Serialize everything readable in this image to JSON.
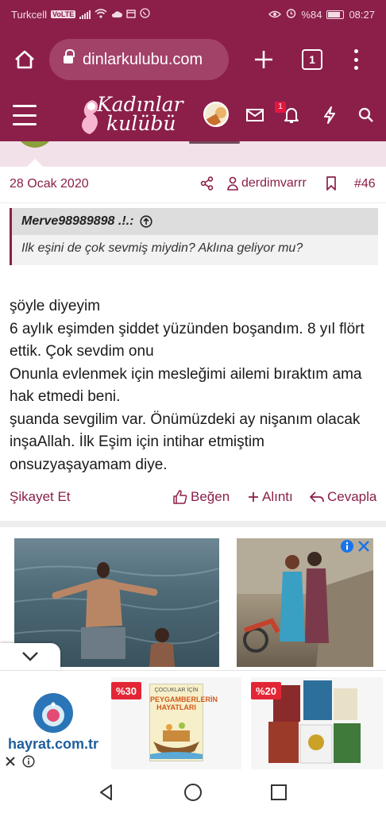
{
  "status_bar": {
    "carrier": "Turkcell",
    "network_badge": "VoLTE",
    "battery_percent": "%84",
    "time": "08:27"
  },
  "browser": {
    "url": "dinlarkulubu.com",
    "tab_count": "1"
  },
  "site_header": {
    "logo_line1": "Kadınlar",
    "logo_line2": "kulübü",
    "notification_count": "1"
  },
  "post": {
    "date": "28 Ocak 2020",
    "author": "derdimvarrr",
    "post_number": "#46",
    "quote": {
      "author": "Merve98989898 .!.:",
      "text": "Ilk eşini de çok sevmiş miydin? Aklına geliyor mu?"
    },
    "body": "şöyle diyeyim\n6 aylık eşimden şiddet yüzünden boşandım. 8 yıl flört ettik. Çok sevdim onu\nOnunla evlenmek için mesleğimi ailemi bıraktım ama hak etmedi beni.\nşuanda sevgilim var. Önümüzdeki ay nişanım olacak inşaAllah. İlk Eşim için intihar etmiştim onsuzyaşayamam diye.",
    "actions": {
      "report": "Şikayet Et",
      "like": "Beğen",
      "quote": "Alıntı",
      "reply": "Cevapla"
    }
  },
  "bottom_ad": {
    "brand": "hayrat.com.tr",
    "discount1": "%30",
    "discount2": "%20",
    "book1_top": "ÇOCUKLAR İÇİN",
    "book1_title": "PEYGAMBERLERİN HAYATLARI"
  },
  "colors": {
    "brand": "#8b1f4a",
    "brand_light": "#f3e1ea",
    "discount_red": "#e32636",
    "adchoice_blue": "#1a73e8"
  }
}
